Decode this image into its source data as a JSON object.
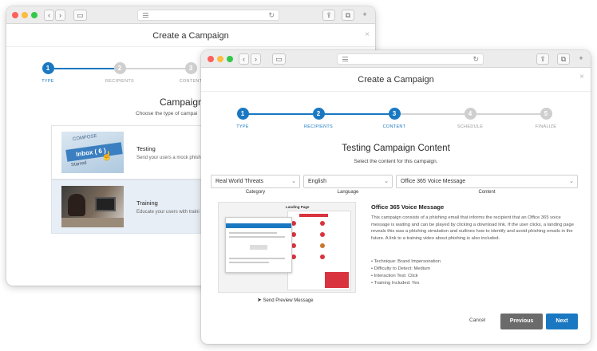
{
  "back_window": {
    "modal_title": "Create a Campaign",
    "steps": [
      {
        "number": "1",
        "label": "TYPE"
      },
      {
        "number": "2",
        "label": "RECIPIENTS"
      },
      {
        "number": "3",
        "label": "CONTENT"
      }
    ],
    "heading": "Campaign",
    "subheading": "Choose the type of campai",
    "options": [
      {
        "title": "Testing",
        "description": "Send your users a mock phish",
        "image_text": [
          "COMPOSE",
          "Inbox ( 6 )",
          "Starred"
        ]
      },
      {
        "title": "Training",
        "description": "Educate your users with traini"
      }
    ]
  },
  "front_window": {
    "modal_title": "Create a Campaign",
    "steps": [
      {
        "number": "1",
        "label": "TYPE",
        "state": "done"
      },
      {
        "number": "2",
        "label": "RECIPIENTS",
        "state": "done"
      },
      {
        "number": "3",
        "label": "CONTENT",
        "state": "active"
      },
      {
        "number": "4",
        "label": "SCHEDULE",
        "state": "pending"
      },
      {
        "number": "5",
        "label": "FINALIZE",
        "state": "pending"
      }
    ],
    "heading": "Testing Campaign Content",
    "subheading": "Select the content for this campaign.",
    "filters": {
      "category": {
        "value": "Real World Threats",
        "label": "Category"
      },
      "language": {
        "value": "English",
        "label": "Language"
      },
      "content": {
        "value": "Office 365 Voice Message",
        "label": "Content"
      }
    },
    "preview": {
      "landing_page_title": "Landing Page",
      "send_preview_label": "Send Preview Message"
    },
    "details": {
      "title": "Office 365 Voice Message",
      "description": "This campaign consists of a phishing email that informs the recipient that an Office 365 voice message is waiting and can be played by clicking a download link. If the user clicks, a landing page reveals this was a phishing simulation and outlines how to identify and avoid phishing emails in the future. A link to a training video about phishing is also included.",
      "bullets": [
        "• Technique: Brand Impersonation",
        "• Difficulty to Detect: Medium",
        "• Interaction Test: Click",
        "• Training Included: Yes"
      ]
    },
    "buttons": {
      "cancel": "Cancel",
      "previous": "Previous",
      "next": "Next"
    }
  },
  "colors": {
    "accent": "#1a78c2",
    "step_inactive": "#cfcfcf",
    "previous_button": "#6b6b6b",
    "training_row_bg": "#e8eef5"
  }
}
